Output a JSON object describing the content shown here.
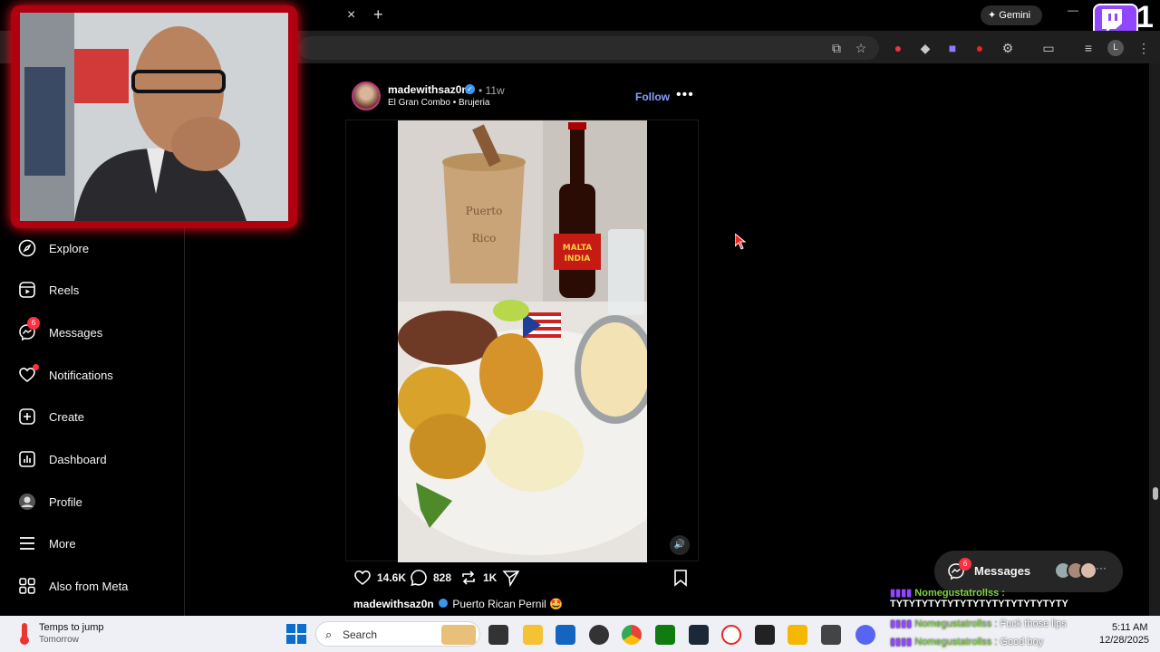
{
  "browser": {
    "tab_close": "×",
    "new_tab": "+",
    "gemini_label": "Gemini",
    "minimize": "—",
    "profile_initial": "L"
  },
  "sidebar": {
    "items": [
      {
        "label": "Explore",
        "icon": "compass-icon"
      },
      {
        "label": "Reels",
        "icon": "reels-icon"
      },
      {
        "label": "Messages",
        "icon": "messenger-icon",
        "badge": "6"
      },
      {
        "label": "Notifications",
        "icon": "heart-icon"
      },
      {
        "label": "Create",
        "icon": "plus-square-icon"
      },
      {
        "label": "Dashboard",
        "icon": "chart-icon"
      },
      {
        "label": "Profile",
        "icon": "avatar-icon"
      },
      {
        "label": "More",
        "icon": "menu-icon"
      },
      {
        "label": "Also from Meta",
        "icon": "meta-grid-icon"
      }
    ]
  },
  "post": {
    "username": "madewithsaz0n",
    "verified_mark": "✓",
    "separator": "•",
    "age": "11w",
    "music_artist": "El Gran Combo",
    "music_dot": "•",
    "music_track": "Brujeria",
    "follow_label": "Follow",
    "more_label": "•••",
    "likes": "14.6K",
    "comments": "828",
    "reposts": "1K",
    "caption_user": "madewithsaz0n",
    "caption_text": "Puerto Rican Pernil 🤩",
    "photo_text_mortar": "Puerto Rico",
    "photo_text_bottle": "MALTA INDIA"
  },
  "messages_pill": {
    "label": "Messages",
    "badge": "6"
  },
  "chat": {
    "user1": "Nomegustatrollss :",
    "line1": "TYTYTYTYTYTYTYTYTYTYTYTYTYTY",
    "user2": "Nomegustatrollss :",
    "line2": "Fuck those lips",
    "user3": "Nomegustatrollss :",
    "line3": "Good boy"
  },
  "taskbar": {
    "weather_title": "Temps to jump",
    "weather_sub": "Tomorrow",
    "search_label": "Search",
    "time": "5:11 AM",
    "date": "12/28/2025",
    "twitch_count": "1"
  },
  "colors": {
    "accent": "#85a1ff",
    "badge": "#ff3040",
    "cam_border": "#b10010"
  }
}
